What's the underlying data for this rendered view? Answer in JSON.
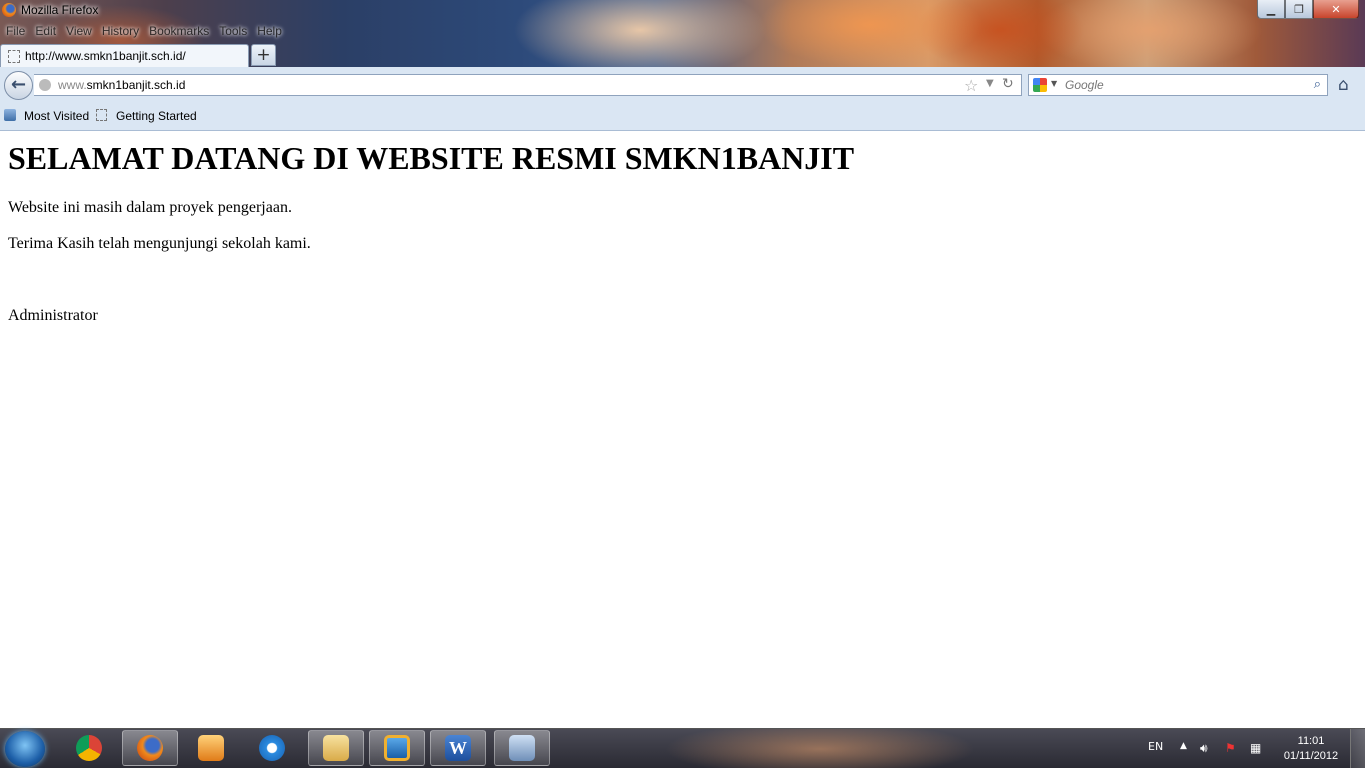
{
  "window": {
    "title": "Mozilla Firefox"
  },
  "menu": [
    "File",
    "Edit",
    "View",
    "History",
    "Bookmarks",
    "Tools",
    "Help"
  ],
  "tab": {
    "title": "http://www.smkn1banjit.sch.id/",
    "new_tab_label": "+"
  },
  "navbar": {
    "url_prefix": "www.",
    "url_main": "smkn1banjit.sch.id",
    "search_placeholder": "Google"
  },
  "bookmarks": [
    "Most Visited",
    "Getting Started"
  ],
  "page": {
    "heading": "SELAMAT DATANG DI WEBSITE RESMI SMKN1BANJIT",
    "line1": "Website ini masih dalam proyek pengerjaan.",
    "line2": "Terima Kasih telah mengunjungi sekolah kami.",
    "signature": "Administrator"
  },
  "taskbar": {
    "apps": [
      "chrome-icon",
      "firefox-icon",
      "media-player-icon",
      "ie-icon",
      "explorer-icon",
      "virtualbox-icon",
      "word-icon",
      "network-app-icon"
    ],
    "language": "EN",
    "time": "11:01",
    "date": "01/11/2012"
  }
}
